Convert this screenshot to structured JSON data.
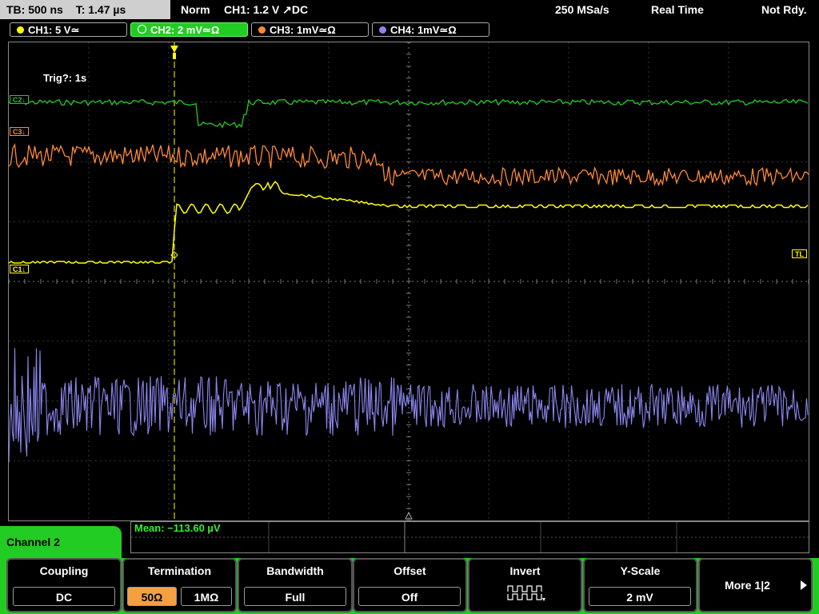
{
  "topbar": {
    "timebase": "TB: 500 ns",
    "time": "T: 1.47 µs",
    "mode": "Norm",
    "trigger": "CH1: 1.2 V ↗DC",
    "sample_rate": "250 MSa/s",
    "acq": "Real Time",
    "state": "Not Rdy."
  },
  "channels": [
    {
      "label": "CH1: 5 V≃",
      "color": "#ffff00"
    },
    {
      "label": "CH2: 2 mV≃Ω",
      "color": "#22cc22"
    },
    {
      "label": "CH3: 1mV≃Ω",
      "color": "#ff8a33"
    },
    {
      "label": "CH4: 1mV≃Ω",
      "color": "#8b86ee"
    }
  ],
  "trig_status": "Trig?: 1s",
  "tags": {
    "c2": "C2↓",
    "c3": "C3↓",
    "c1": "C1↓",
    "tl": "TL"
  },
  "measurement": "Mean: −113.60 µV",
  "menu_title": "Channel 2",
  "softkeys": {
    "coupling": {
      "title": "Coupling",
      "value": "DC"
    },
    "termination": {
      "title": "Termination",
      "opt1": "50Ω",
      "opt2": "1MΩ"
    },
    "bandwidth": {
      "title": "Bandwidth",
      "value": "Full"
    },
    "offset": {
      "title": "Offset",
      "value": "Off"
    },
    "invert": {
      "title": "Invert"
    },
    "yscale": {
      "title": "Y-Scale",
      "value": "2 mV"
    },
    "more": {
      "title": "More 1|2"
    }
  },
  "colors": {
    "accent": "#22cc22",
    "grid": "#555555",
    "selected": "#f5a040"
  }
}
